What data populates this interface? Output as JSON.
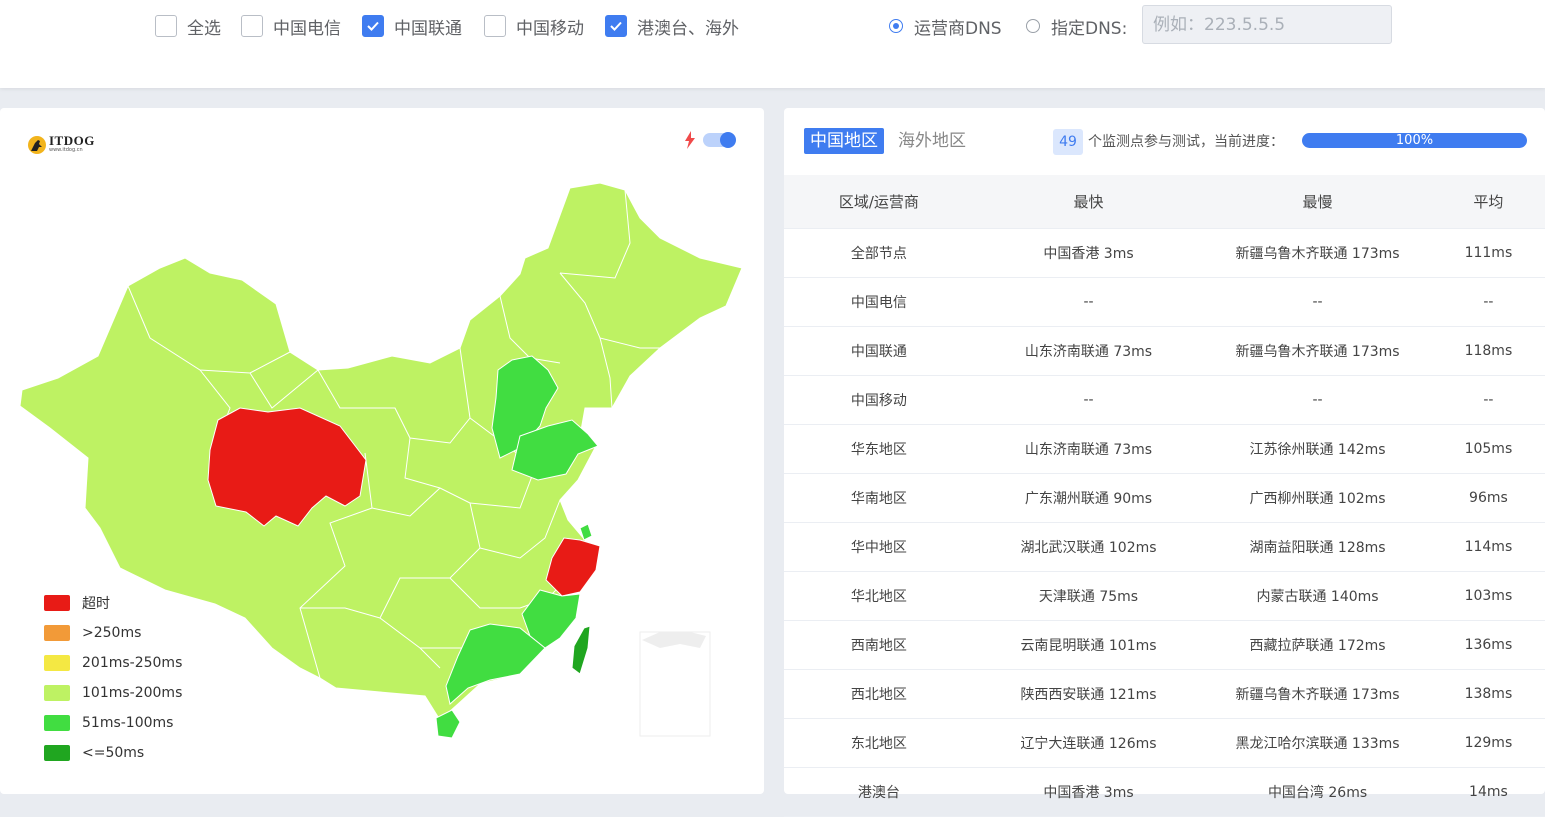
{
  "filters": {
    "carriers": [
      {
        "label": "全选",
        "checked": false
      },
      {
        "label": "中国电信",
        "checked": false
      },
      {
        "label": "中国联通",
        "checked": true
      },
      {
        "label": "中国移动",
        "checked": false
      },
      {
        "label": "港澳台、海外",
        "checked": true
      }
    ],
    "dns": {
      "option_operator": "运营商DNS",
      "option_custom": "指定DNS:",
      "selected": "operator",
      "input_placeholder": "例如：223.5.5.5",
      "input_value": ""
    }
  },
  "map": {
    "logo_brand": "ITDOG",
    "logo_url": "www.itdog.cn",
    "toggle_on": true,
    "legend": [
      {
        "label": "超时",
        "color": "#e81b16"
      },
      {
        "label": ">250ms",
        "color": "#f29a38"
      },
      {
        "label": "201ms-250ms",
        "color": "#f4e843"
      },
      {
        "label": "101ms-200ms",
        "color": "#bef263"
      },
      {
        "label": "51ms-100ms",
        "color": "#41dd41"
      },
      {
        "label": "<=50ms",
        "color": "#20a620"
      }
    ]
  },
  "results": {
    "tabs": [
      {
        "label": "中国地区",
        "active": true
      },
      {
        "label": "海外地区",
        "active": false
      }
    ],
    "node_count": "49",
    "count_text": "个监测点参与测试，当前进度：",
    "progress_label": "100%",
    "progress": 1.0,
    "columns": [
      "区域/运营商",
      "最快",
      "最慢",
      "平均"
    ],
    "rows": [
      [
        "全部节点",
        "中国香港 3ms",
        "新疆乌鲁木齐联通 173ms",
        "111ms"
      ],
      [
        "中国电信",
        "--",
        "--",
        "--"
      ],
      [
        "中国联通",
        "山东济南联通 73ms",
        "新疆乌鲁木齐联通 173ms",
        "118ms"
      ],
      [
        "中国移动",
        "--",
        "--",
        "--"
      ],
      [
        "华东地区",
        "山东济南联通 73ms",
        "江苏徐州联通 142ms",
        "105ms"
      ],
      [
        "华南地区",
        "广东潮州联通 90ms",
        "广西柳州联通 102ms",
        "96ms"
      ],
      [
        "华中地区",
        "湖北武汉联通 102ms",
        "湖南益阳联通 128ms",
        "114ms"
      ],
      [
        "华北地区",
        "天津联通 75ms",
        "内蒙古联通 140ms",
        "103ms"
      ],
      [
        "西南地区",
        "云南昆明联通 101ms",
        "西藏拉萨联通 172ms",
        "136ms"
      ],
      [
        "西北地区",
        "陕西西安联通 121ms",
        "新疆乌鲁木齐联通 173ms",
        "138ms"
      ],
      [
        "东北地区",
        "辽宁大连联通 126ms",
        "黑龙江哈尔滨联通 133ms",
        "129ms"
      ],
      [
        "港澳台",
        "中国香港 3ms",
        "中国台湾 26ms",
        "14ms"
      ]
    ]
  }
}
